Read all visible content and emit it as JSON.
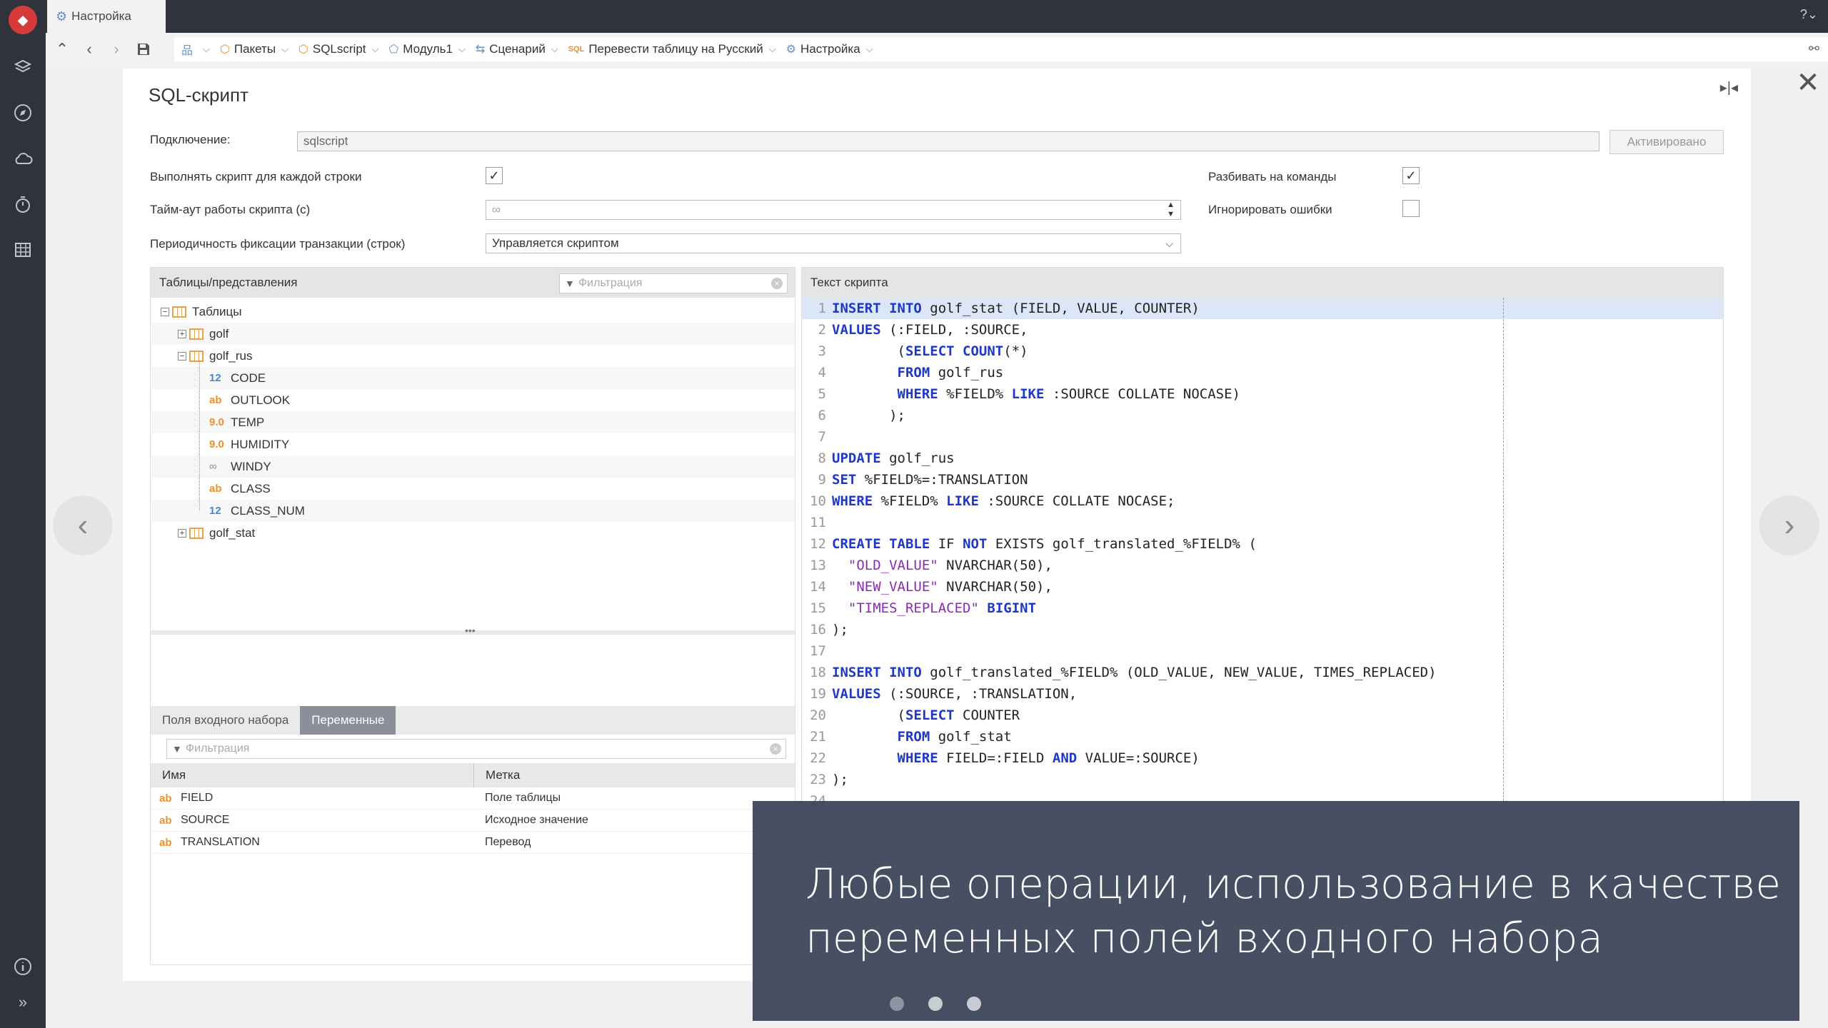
{
  "window": {
    "active_tab": "Настройка"
  },
  "breadcrumbs": [
    {
      "icon": "nodes-icon",
      "label": ""
    },
    {
      "icon": "package-icon",
      "label": "Пакеты"
    },
    {
      "icon": "package-icon",
      "label": "SQLscript"
    },
    {
      "icon": "module-icon",
      "label": "Модуль1"
    },
    {
      "icon": "scenario-icon",
      "label": "Сценарий"
    },
    {
      "icon": "sql-icon",
      "label": "Перевести таблицу на Русский"
    },
    {
      "icon": "gear-icon",
      "label": "Настройка"
    }
  ],
  "dialog": {
    "title": "SQL-скрипт",
    "connection_label": "Подключение:",
    "connection_value": "sqlscript",
    "activate_label": "Активировано",
    "per_row_label": "Выполнять скрипт для каждой строки",
    "per_row_checked": true,
    "split_label": "Разбивать на команды",
    "split_checked": true,
    "timeout_label": "Тайм-аут работы скрипта (с)",
    "timeout_value": "∞",
    "ignore_errors_label": "Игнорировать ошибки",
    "ignore_errors_checked": false,
    "commit_label": "Периодичность фиксации транзакции (строк)",
    "commit_value": "Управляется скриптом"
  },
  "tables_panel": {
    "title": "Таблицы/представления",
    "filter_placeholder": "Фильтрация",
    "root": "Таблицы",
    "nodes": [
      {
        "label": "golf",
        "type": "table"
      },
      {
        "label": "golf_rus",
        "type": "table"
      },
      {
        "label": "CODE",
        "type": "12"
      },
      {
        "label": "OUTLOOK",
        "type": "ab"
      },
      {
        "label": "TEMP",
        "type": "9.0"
      },
      {
        "label": "HUMIDITY",
        "type": "9.0"
      },
      {
        "label": "WINDY",
        "type": "∞"
      },
      {
        "label": "CLASS",
        "type": "ab"
      },
      {
        "label": "CLASS_NUM",
        "type": "12"
      },
      {
        "label": "golf_stat",
        "type": "table"
      }
    ]
  },
  "variables_panel": {
    "tabs": [
      "Поля входного набора",
      "Переменные"
    ],
    "active_tab": "Переменные",
    "filter_placeholder": "Фильтрация",
    "columns": [
      "Имя",
      "Метка"
    ],
    "rows": [
      {
        "type": "ab",
        "name": "FIELD",
        "label": "Поле таблицы"
      },
      {
        "type": "ab",
        "name": "SOURCE",
        "label": "Исходное значение"
      },
      {
        "type": "ab",
        "name": "TRANSLATION",
        "label": "Перевод"
      }
    ]
  },
  "script_panel": {
    "title": "Текст скрипта",
    "lines": [
      "INSERT INTO golf_stat (FIELD, VALUE, COUNTER)",
      "VALUES (:FIELD, :SOURCE,",
      "        (SELECT COUNT(*)",
      "        FROM golf_rus",
      "        WHERE %FIELD% LIKE :SOURCE COLLATE NOCASE)",
      "       );",
      "",
      "UPDATE golf_rus",
      "SET %FIELD%=:TRANSLATION",
      "WHERE %FIELD% LIKE :SOURCE COLLATE NOCASE;",
      "",
      "CREATE TABLE IF NOT EXISTS golf_translated_%FIELD% (",
      "  \"OLD_VALUE\" NVARCHAR(50),",
      "  \"NEW_VALUE\" NVARCHAR(50),",
      "  \"TIMES_REPLACED\" BIGINT",
      ");",
      "",
      "INSERT INTO golf_translated_%FIELD% (OLD_VALUE, NEW_VALUE, TIMES_REPLACED)",
      "VALUES (:SOURCE, :TRANSLATION,",
      "        (SELECT COUNTER",
      "        FROM golf_stat",
      "        WHERE FIELD=:FIELD AND VALUE=:SOURCE)",
      ");",
      ""
    ]
  },
  "caption": {
    "line1": "Любые операции, использование в качестве",
    "line2": "переменных полей входного набора"
  }
}
